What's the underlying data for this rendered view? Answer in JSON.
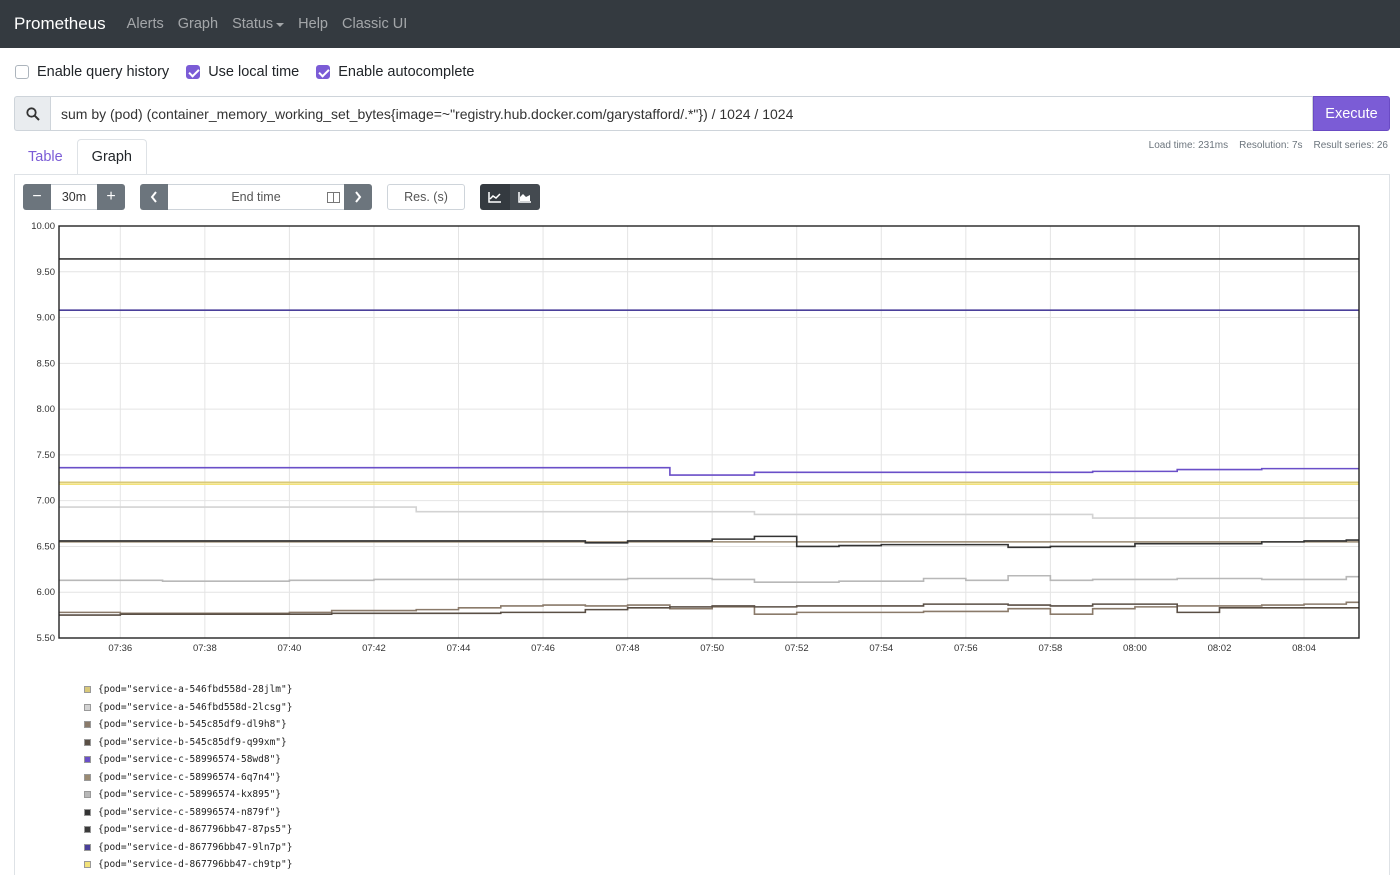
{
  "navbar": {
    "brand": "Prometheus",
    "links": [
      "Alerts",
      "Graph",
      "Status",
      "Help",
      "Classic UI"
    ]
  },
  "options": [
    {
      "label": "Enable query history",
      "checked": false
    },
    {
      "label": "Use local time",
      "checked": true
    },
    {
      "label": "Enable autocomplete",
      "checked": true
    }
  ],
  "query": {
    "expression": "sum by (pod) (container_memory_working_set_bytes{image=~\"registry.hub.docker.com/garystafford/.*\"}) / 1024 / 1024",
    "execute_label": "Execute"
  },
  "tabs": {
    "table_label": "Table",
    "graph_label": "Graph",
    "active": "Graph"
  },
  "stats": {
    "load_time": "Load time: 231ms",
    "resolution": "Resolution: 7s",
    "result_series": "Result series: 26"
  },
  "controls": {
    "minus_label": "−",
    "range": "30m",
    "plus_label": "+",
    "end_time_placeholder": "End time",
    "resolution_placeholder": "Res. (s)",
    "mode": "lines"
  },
  "chart_data": {
    "type": "line",
    "xlabel": "",
    "ylabel": "",
    "ylim": [
      5.5,
      10.0
    ],
    "y_ticks": [
      "10.00",
      "9.50",
      "9.00",
      "8.50",
      "8.00",
      "7.50",
      "7.00",
      "6.50",
      "6.00",
      "5.50"
    ],
    "x_ticks": [
      "07:36",
      "07:38",
      "07:40",
      "07:42",
      "07:44",
      "07:46",
      "07:48",
      "07:50",
      "07:52",
      "07:54",
      "07:56",
      "07:58",
      "08:00",
      "08:02",
      "08:04"
    ],
    "grid": true,
    "x": [
      "07:35",
      "07:36",
      "07:37",
      "07:38",
      "07:39",
      "07:40",
      "07:41",
      "07:42",
      "07:43",
      "07:44",
      "07:45",
      "07:46",
      "07:47",
      "07:48",
      "07:49",
      "07:50",
      "07:51",
      "07:52",
      "07:53",
      "07:54",
      "07:55",
      "07:56",
      "07:57",
      "07:58",
      "07:59",
      "08:00",
      "08:01",
      "08:02",
      "08:03",
      "08:04",
      "08:05"
    ],
    "series": [
      {
        "name": "{pod=\"service-a-546fbd558d-28jlm\"}",
        "color": "#d9c97a",
        "values": [
          7.2,
          7.2,
          7.2,
          7.2,
          7.2,
          7.2,
          7.2,
          7.2,
          7.2,
          7.2,
          7.2,
          7.2,
          7.2,
          7.2,
          7.2,
          7.2,
          7.2,
          7.2,
          7.2,
          7.2,
          7.2,
          7.2,
          7.2,
          7.2,
          7.2,
          7.2,
          7.2,
          7.2,
          7.2,
          7.2,
          7.2
        ]
      },
      {
        "name": "{pod=\"service-a-546fbd558d-2lcsg\"}",
        "color": "#d3d3d3",
        "values": [
          6.93,
          6.93,
          6.93,
          6.93,
          6.93,
          6.93,
          6.93,
          6.93,
          6.88,
          6.88,
          6.88,
          6.88,
          6.88,
          6.88,
          6.88,
          6.88,
          6.85,
          6.85,
          6.85,
          6.85,
          6.85,
          6.85,
          6.85,
          6.85,
          6.81,
          6.81,
          6.81,
          6.81,
          6.81,
          6.81,
          6.81
        ]
      },
      {
        "name": "{pod=\"service-b-545c85df9-dl9h8\"}",
        "color": "#8a7a6a",
        "values": [
          5.78,
          5.77,
          5.77,
          5.77,
          5.77,
          5.78,
          5.8,
          5.8,
          5.81,
          5.83,
          5.85,
          5.86,
          5.85,
          5.86,
          5.82,
          5.84,
          5.76,
          5.78,
          5.78,
          5.78,
          5.79,
          5.79,
          5.82,
          5.76,
          5.82,
          5.84,
          5.85,
          5.85,
          5.86,
          5.87,
          5.89
        ]
      },
      {
        "name": "{pod=\"service-b-545c85df9-q99xm\"}",
        "color": "#5a4f45",
        "values": [
          5.75,
          5.76,
          5.76,
          5.76,
          5.76,
          5.76,
          5.77,
          5.77,
          5.77,
          5.77,
          5.78,
          5.78,
          5.81,
          5.83,
          5.84,
          5.85,
          5.84,
          5.85,
          5.85,
          5.85,
          5.87,
          5.87,
          5.86,
          5.85,
          5.87,
          5.87,
          5.78,
          5.83,
          5.83,
          5.83,
          5.83
        ]
      },
      {
        "name": "{pod=\"service-c-58996574-58wd8\"}",
        "color": "#6a4fc8",
        "values": [
          7.36,
          7.36,
          7.36,
          7.36,
          7.36,
          7.36,
          7.36,
          7.36,
          7.36,
          7.36,
          7.36,
          7.36,
          7.36,
          7.36,
          7.28,
          7.28,
          7.31,
          7.31,
          7.31,
          7.31,
          7.31,
          7.31,
          7.31,
          7.31,
          7.32,
          7.32,
          7.34,
          7.34,
          7.35,
          7.35,
          7.35
        ]
      },
      {
        "name": "{pod=\"service-c-58996574-6q7n4\"}",
        "color": "#9a8a72",
        "values": [
          6.55,
          6.55,
          6.55,
          6.55,
          6.55,
          6.55,
          6.55,
          6.55,
          6.55,
          6.55,
          6.55,
          6.55,
          6.55,
          6.55,
          6.55,
          6.55,
          6.55,
          6.55,
          6.55,
          6.55,
          6.55,
          6.55,
          6.55,
          6.55,
          6.55,
          6.55,
          6.55,
          6.55,
          6.55,
          6.55,
          6.55
        ]
      },
      {
        "name": "{pod=\"service-c-58996574-kx895\"}",
        "color": "#b8b8b8",
        "values": [
          6.13,
          6.13,
          6.12,
          6.12,
          6.12,
          6.13,
          6.13,
          6.14,
          6.14,
          6.14,
          6.14,
          6.14,
          6.14,
          6.15,
          6.15,
          6.14,
          6.11,
          6.11,
          6.12,
          6.12,
          6.15,
          6.13,
          6.18,
          6.13,
          6.14,
          6.14,
          6.15,
          6.15,
          6.14,
          6.14,
          6.17
        ]
      },
      {
        "name": "{pod=\"service-c-58996574-n879f\"}",
        "color": "#333333",
        "values": [
          6.56,
          6.56,
          6.56,
          6.56,
          6.56,
          6.56,
          6.56,
          6.56,
          6.56,
          6.56,
          6.56,
          6.56,
          6.54,
          6.56,
          6.56,
          6.58,
          6.61,
          6.5,
          6.51,
          6.52,
          6.52,
          6.52,
          6.49,
          6.5,
          6.5,
          6.53,
          6.53,
          6.53,
          6.55,
          6.56,
          6.57
        ]
      },
      {
        "name": "{pod=\"service-d-867796bb47-87ps5\"}",
        "color": "#3a3a3a",
        "values": [
          9.64,
          9.64,
          9.64,
          9.64,
          9.64,
          9.64,
          9.64,
          9.64,
          9.64,
          9.64,
          9.64,
          9.64,
          9.64,
          9.64,
          9.64,
          9.64,
          9.64,
          9.64,
          9.64,
          9.64,
          9.64,
          9.64,
          9.64,
          9.64,
          9.64,
          9.64,
          9.64,
          9.64,
          9.64,
          9.64,
          9.64
        ]
      },
      {
        "name": "{pod=\"service-d-867796bb47-9ln7p\"}",
        "color": "#4a3f9a",
        "values": [
          9.08,
          9.08,
          9.08,
          9.08,
          9.08,
          9.08,
          9.08,
          9.08,
          9.08,
          9.08,
          9.08,
          9.08,
          9.08,
          9.08,
          9.08,
          9.08,
          9.08,
          9.08,
          9.08,
          9.08,
          9.08,
          9.08,
          9.08,
          9.08,
          9.08,
          9.08,
          9.08,
          9.08,
          9.08,
          9.08,
          9.08
        ]
      },
      {
        "name": "{pod=\"service-d-867796bb47-ch9tp\"}",
        "color": "#f2e27a",
        "values": [
          7.18,
          7.18,
          7.18,
          7.18,
          7.18,
          7.18,
          7.18,
          7.18,
          7.18,
          7.18,
          7.18,
          7.18,
          7.18,
          7.18,
          7.18,
          7.18,
          7.18,
          7.18,
          7.18,
          7.18,
          7.18,
          7.18,
          7.18,
          7.18,
          7.18,
          7.18,
          7.18,
          7.18,
          7.18,
          7.18,
          7.18
        ]
      }
    ]
  }
}
